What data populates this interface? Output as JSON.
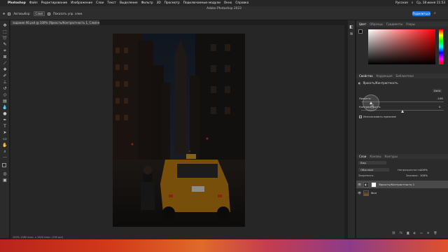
{
  "menubar": {
    "app_name": "Photoshop",
    "items": [
      "Файл",
      "Редактирование",
      "Изображение",
      "Слои",
      "Текст",
      "Выделение",
      "Фильтр",
      "3D",
      "Просмотр",
      "Подключаемые модули",
      "Окно",
      "Справка"
    ],
    "keyboard_layout": "Русская",
    "datetime": "Ср, 18 июня 11:53"
  },
  "window": {
    "title": "Adobe Photoshop 2023"
  },
  "options": {
    "autoselect_label": "Автовыбор:",
    "autoselect_value": "Слой",
    "transform_label": "Показать упр. элем.",
    "share_label": "Поделиться"
  },
  "document": {
    "tab_title": "задание 06.psd @ 100% (Яркость/Контрастность 1, Слой-маска/8) *",
    "status": "100%    1080 пикс. x 1620 пикс. (300 ppi)"
  },
  "color_panel": {
    "tabs": [
      "Цвет",
      "Образцы",
      "Градиенты",
      "Узоры"
    ],
    "fg_color": "#000000",
    "bg_color": "#ffffff"
  },
  "properties_panel": {
    "tabs": [
      "Свойства",
      "Коррекция",
      "Библиотеки"
    ],
    "adjustment_title": "Яркость/Контрастность",
    "auto_label": "Авто",
    "brightness_label": "Яркость:",
    "brightness_value": "-106",
    "contrast_label": "Контрастность:",
    "contrast_value": "0",
    "brightness_fraction": 0.12,
    "contrast_fraction": 0.5,
    "legacy_label": "Использовать прежние"
  },
  "layers_panel": {
    "tabs": [
      "Слои",
      "Каналы",
      "Контуры"
    ],
    "filter_label": "Вид",
    "blend_mode": "Обычные",
    "opacity_label": "Непрозрачность:",
    "opacity_value": "100%",
    "lock_label": "Закрепить:",
    "fill_label": "Заливка:",
    "fill_value": "100%",
    "layers": [
      {
        "name": "Яркость/Контрастность 1"
      },
      {
        "name": "Фон"
      }
    ]
  }
}
